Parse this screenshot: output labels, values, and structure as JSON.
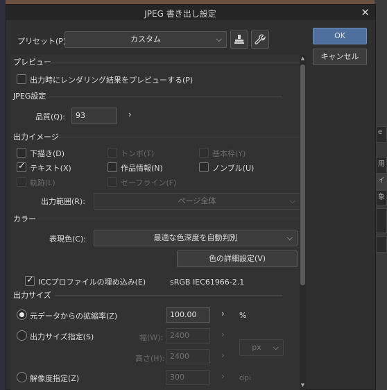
{
  "dialog": {
    "title": "JPEG 書き出し設定",
    "close": "✕"
  },
  "preset": {
    "label": "プリセット(P):",
    "value": "カスタム"
  },
  "buttons": {
    "ok": "OK",
    "cancel": "キャンセル",
    "color_detail": "色の詳細設定(V)"
  },
  "preview": {
    "title": "プレビュー",
    "checkbox_label": "出力時にレンダリング結果をプレビューする(P)",
    "checked": false
  },
  "jpeg": {
    "title": "JPEG設定",
    "quality_label": "品質(Q):",
    "quality_value": "93"
  },
  "output_image": {
    "title": "出力イメージ",
    "items": [
      {
        "label": "下描き(D)",
        "checked": false,
        "enabled": true
      },
      {
        "label": "トンボ(T)",
        "checked": false,
        "enabled": false
      },
      {
        "label": "基本枠(Y)",
        "checked": false,
        "enabled": false
      },
      {
        "label": "テキスト(X)",
        "checked": true,
        "enabled": true
      },
      {
        "label": "作品情報(N)",
        "checked": false,
        "enabled": true
      },
      {
        "label": "ノンブル(U)",
        "checked": false,
        "enabled": true
      },
      {
        "label": "軌跡(L)",
        "checked": false,
        "enabled": false
      },
      {
        "label": "セーフライン(F)",
        "checked": false,
        "enabled": false
      }
    ],
    "range_label": "出力範囲(R):",
    "range_value": "ページ全体"
  },
  "color": {
    "title": "カラー",
    "expression_label": "表現色(C):",
    "expression_value": "最適な色深度を自動判別",
    "icc_label": "ICCプロファイルの埋め込み(E)",
    "icc_checked": true,
    "icc_profile": "sRGB IEC61966-2.1"
  },
  "output_size": {
    "title": "出力サイズ",
    "scale_label": "元データからの拡縮率(Z)",
    "scale_value": "100.00",
    "scale_unit": "%",
    "size_label": "出力サイズ指定(S)",
    "width_label": "幅(W):",
    "width_value": "2400",
    "height_label": "高さ(H):",
    "height_value": "2400",
    "unit_value": "px",
    "resolution_label": "解像度指定(Z)",
    "resolution_value": "300",
    "resolution_unit": "dpi"
  },
  "background": {
    "right_labels": [
      "e",
      "用",
      "イ",
      "象"
    ]
  },
  "icons": {
    "chevron_down": "⌵",
    "chevron_right": "›",
    "close": "✕"
  }
}
